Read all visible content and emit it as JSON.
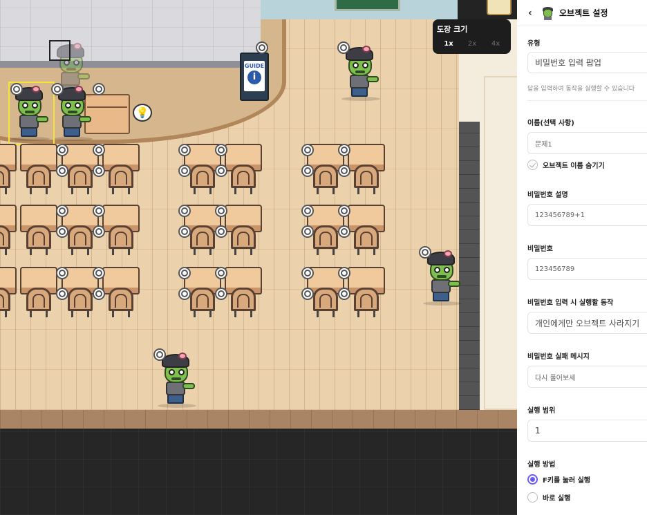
{
  "map": {
    "guide_sign_text": "GUIDE",
    "guide_sign_icon": "info-icon",
    "hint_icon": "lightbulb-icon",
    "zoom": {
      "title": "도장 크기",
      "options": [
        "1x",
        "2x",
        "4x"
      ],
      "selected": "1x"
    }
  },
  "panel": {
    "title": "오브젝트 설정",
    "type": {
      "label": "유형",
      "value": "비밀번호 입력 팝업",
      "description": "답을 입력하여 동작을 실행할 수 있습니다"
    },
    "name": {
      "label": "이름(선택 사항)",
      "value": "문제1",
      "hide_label": "오브젝트 이름 숨기기"
    },
    "password_desc": {
      "label": "비밀번호 설명",
      "value": "123456789+1"
    },
    "password": {
      "label": "비밀번호",
      "value": "123456789"
    },
    "action": {
      "label": "비밀번호 입력 시 실행할 동작",
      "value": "개인에게만 오브젝트 사라지기"
    },
    "fail_message": {
      "label": "비밀번호 실패 메시지",
      "value": "다시 풀어보세"
    },
    "range": {
      "label": "실행 범위",
      "value": "1"
    },
    "method": {
      "label": "실행 방법",
      "options": [
        "F키를 눌러 실행",
        "바로 실행"
      ],
      "selected": "F키를 눌러 실행"
    }
  },
  "colors": {
    "accent": "#6a5cf6",
    "selection_yellow": "#f4e43a",
    "floor": "#ebd2ad"
  }
}
